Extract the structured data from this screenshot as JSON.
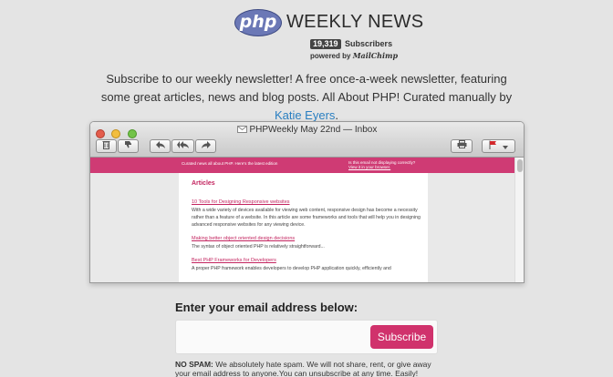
{
  "brand": {
    "logo_mark": "php",
    "logo_text": "WEEKLY NEWS",
    "subscriber_count": "19,319",
    "subscriber_label": "Subscribers",
    "powered_prefix": "powered by",
    "powered_brand": "MailChimp"
  },
  "intro": {
    "text": "Subscribe to our weekly newsletter! A free once-a-week newsletter, featuring some great articles, news and blog posts. All About PHP! Curated manually by ",
    "link_text": "Katie Eyers",
    "suffix": "."
  },
  "window": {
    "title": "PHPWeekly May 22nd — Inbox",
    "banner_left": "Curated news all about PHP.  Here's the latest edition",
    "banner_right_1": "Is this email not displaying correctly?",
    "banner_right_2": "View it in your browser.",
    "section_heading": "Articles",
    "articles": [
      {
        "title": "10 Tools for Designing Responsive websites",
        "desc": "With a wide variety of devices available for viewing web content, responsive design has become a necessity rather than a feature of a website. In this article are some frameworks and tools that will help you in designing advanced responsive websites for any viewing device."
      },
      {
        "title": "Making better object oriented design decisions",
        "desc": "The syntax of object oriented PHP is relatively straightforward..."
      },
      {
        "title": "Best PHP Frameworks for Developers",
        "desc": "A proper PHP framework enables developers to develop PHP application quickly, efficiently and"
      }
    ]
  },
  "form": {
    "heading": "Enter your email address below:",
    "email_placeholder": "",
    "button_label": "Subscribe"
  },
  "spam": {
    "label": "NO SPAM:",
    "text": " We absolutely hate spam. We will not share, rent, or give away your email address to anyone.You can unsubscribe at any time. Easily!"
  },
  "colors": {
    "accent": "#cf3b74",
    "link": "#2a7fc1",
    "background": "#e4e4e4"
  },
  "icons": [
    "trash-icon",
    "thumbs-down-icon",
    "reply-icon",
    "reply-all-icon",
    "forward-icon",
    "print-icon",
    "flag-icon",
    "mail-icon"
  ]
}
